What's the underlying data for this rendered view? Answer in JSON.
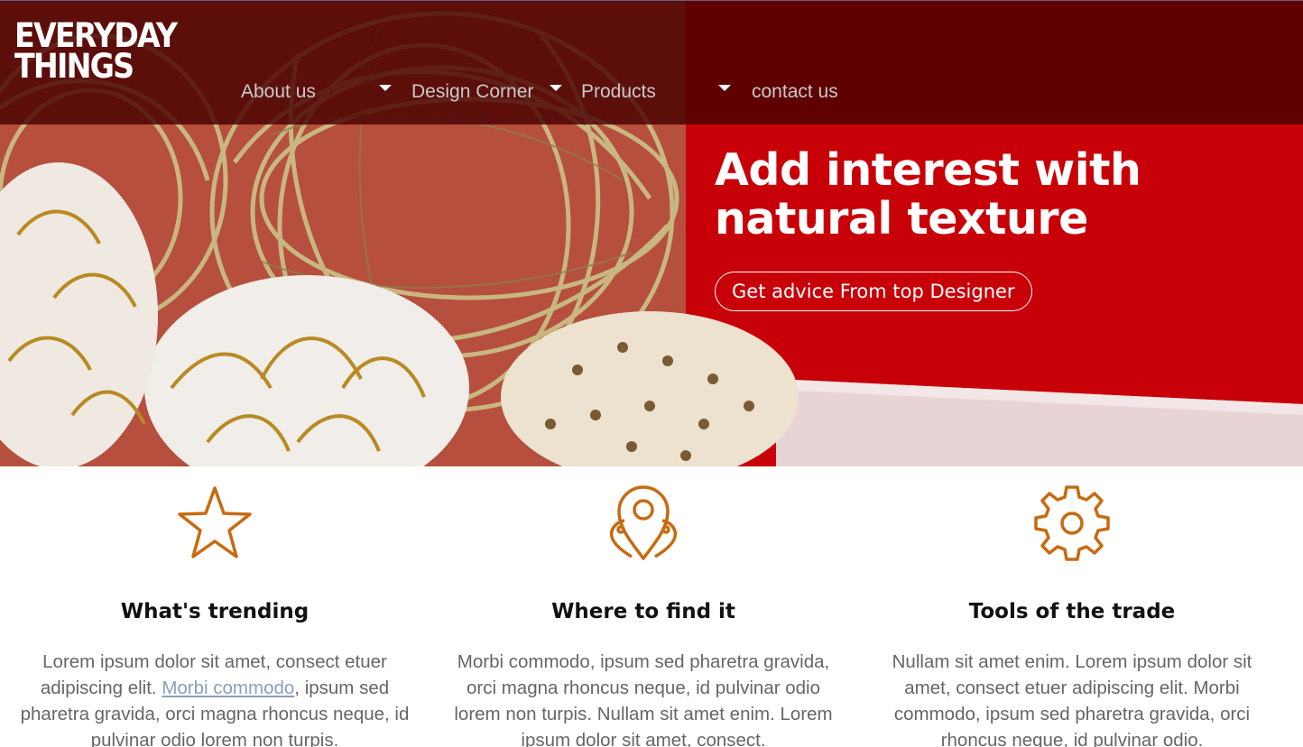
{
  "brand": {
    "line1": "EVERYDAY",
    "line2": "THINGS"
  },
  "nav": [
    {
      "label": "About us",
      "has_dropdown": true
    },
    {
      "label": "Design Corner",
      "has_dropdown": true
    },
    {
      "label": "Products",
      "has_dropdown": true
    },
    {
      "label": "contact us",
      "has_dropdown": false
    }
  ],
  "hero": {
    "headline_line1": "Add interest with",
    "headline_line2": "natural texture",
    "cta_label": "Get advice From top Designer"
  },
  "features": [
    {
      "icon": "star-icon",
      "title": "What's trending",
      "text_before_link": "Lorem ipsum dolor sit amet, consect etuer adipiscing elit. ",
      "link": "Morbi commodo",
      "text_after_link": ", ipsum sed pharetra gravida, orci magna rhoncus neque, id pulvinar odio lorem non turpis."
    },
    {
      "icon": "map-pin-icon",
      "title": "Where to find it",
      "text": "Morbi commodo, ipsum sed pharetra gravida, orci magna rhoncus neque, id pulvinar odio lorem non turpis. Nullam sit amet enim. Lorem ipsum dolor sit amet, consect."
    },
    {
      "icon": "gear-icon",
      "title": "Tools of the trade",
      "text": "Nullam sit amet enim. Lorem ipsum dolor sit amet, consect etuer adipiscing elit. Morbi commodo, ipsum sed pharetra gravida, orci rhoncus neque, id pulvinar odio."
    }
  ],
  "colors": {
    "accent_icon": "#c86a10",
    "topbar": "#480000",
    "hero_red": "#c80008",
    "link": "#8aa0b8"
  }
}
